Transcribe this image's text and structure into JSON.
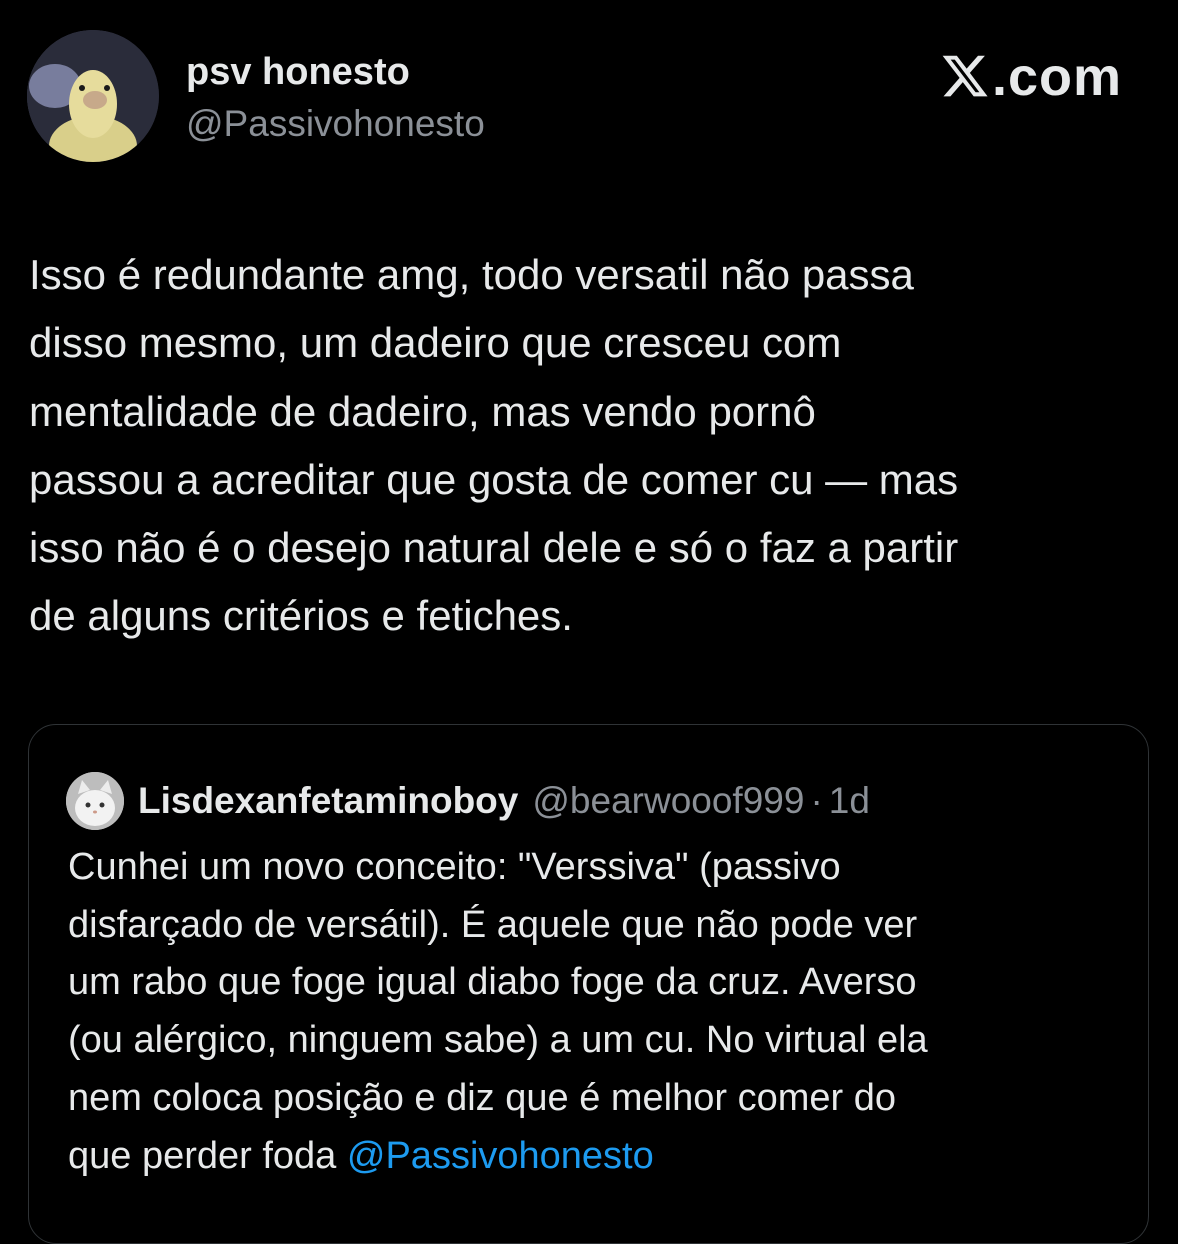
{
  "author": {
    "name": "psv honesto",
    "handle": "@Passivohonesto",
    "avatar": "duck-photo-avatar"
  },
  "brand": {
    "logo_icon": "x-logo-icon",
    "label": ".com"
  },
  "tweet": {
    "text": "Isso é redundante amg, todo versatil não passa\ndisso mesmo, um dadeiro que cresceu com\nmentalidade de dadeiro, mas vendo pornô\npassou a acreditar que gosta de comer cu — mas\nisso não é o desejo natural dele e só o faz a partir\nde alguns critérios e fetiches."
  },
  "quoted_tweet": {
    "avatar": "cat-photo-avatar",
    "name": "Lisdexanfetaminoboy",
    "handle": "@bearwooof999",
    "separator": "·",
    "time": "1d",
    "text": "Cunhei um novo conceito: \"Verssiva\"  (passivo\ndisfarçado de versátil). É aquele que não pode ver\num rabo que foge igual diabo foge da cruz. Averso\n(ou alérgico, ninguem sabe) a um cu. No virtual ela\nnem coloca posição e diz que é melhor comer do\nque perder foda ",
    "mention": "@Passivohonesto"
  },
  "colors": {
    "background": "#000000",
    "text": "#e7e9ea",
    "secondary": "#8b9097",
    "link": "#1d9bf0",
    "border": "#2f3336"
  }
}
